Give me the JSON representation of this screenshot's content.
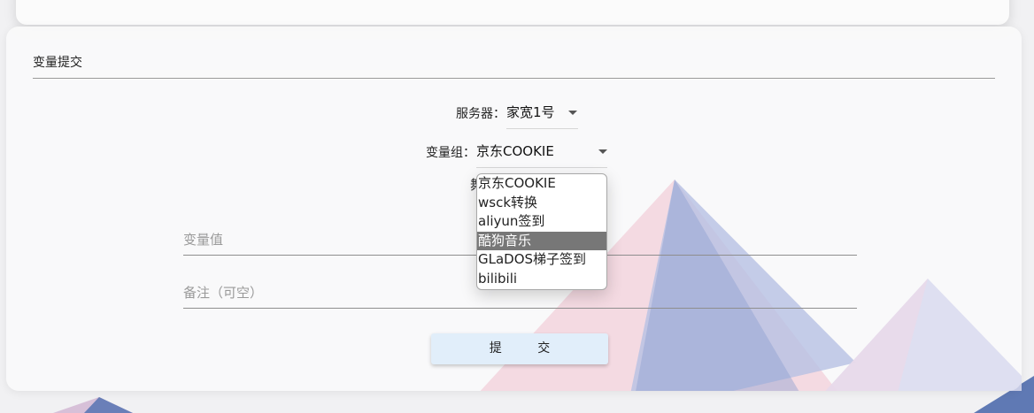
{
  "section": {
    "title": "变量提交"
  },
  "server": {
    "label": "服务器：",
    "value": "家宽1号"
  },
  "variable_group": {
    "label": "变量组：",
    "value": "京东COOKIE",
    "options": [
      "京东COOKIE",
      "wsck转换",
      "aliyun签到",
      "酷狗音乐",
      "GLaDOS梯子签到",
      "bilibili"
    ],
    "highlighted_index": 3
  },
  "ghost_char": "舞",
  "fields": {
    "value_placeholder": "变量值",
    "note_placeholder": "备注（可空）"
  },
  "submit": {
    "label": "提 交"
  },
  "colors": {
    "pink": "#f0c8d4",
    "blue": "#aab6dc",
    "deep_blue": "#5f79b4",
    "button": "#e1eefa"
  }
}
